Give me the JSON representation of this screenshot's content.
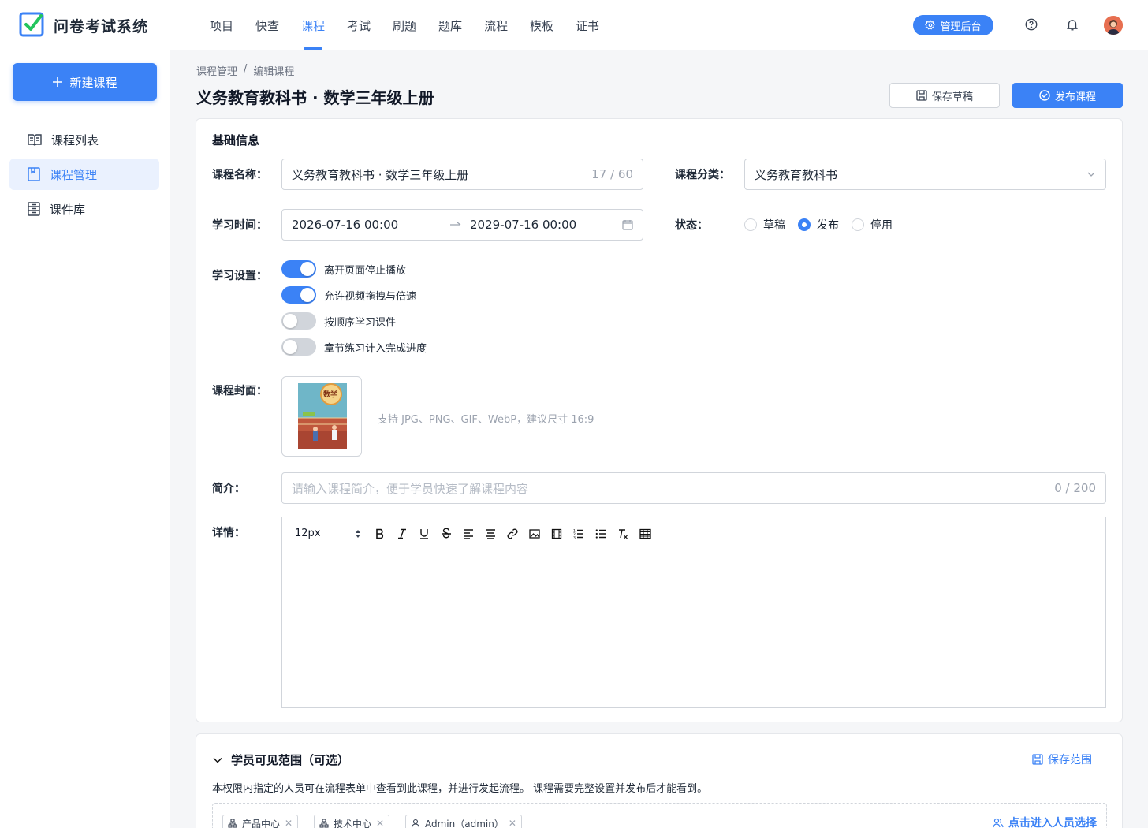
{
  "app": {
    "brand": "问卷考试系统"
  },
  "nav": {
    "items": [
      "项目",
      "快查",
      "课程",
      "考试",
      "刷题",
      "题库",
      "流程",
      "模板",
      "证书"
    ],
    "active": "课程"
  },
  "header": {
    "admin_label": "管理后台"
  },
  "sidebar": {
    "new_label": "新建课程",
    "items": [
      {
        "label": "课程列表"
      },
      {
        "label": "课程管理"
      },
      {
        "label": "课件库"
      }
    ]
  },
  "breadcrumb": {
    "parent": "课程管理",
    "sep": "/",
    "current": "编辑课程"
  },
  "page": {
    "title": "义务教育教科书 · 数学三年级上册",
    "save_draft": "保存草稿",
    "publish": "发布课程"
  },
  "basic": {
    "section_title": "基础信息",
    "name_label": "课程名称：",
    "name_value": "义务教育教科书 · 数学三年级上册",
    "name_count": "17 / 60",
    "category_label": "课程分类：",
    "category_value": "义务教育教科书",
    "time_label": "学习时间：",
    "time_start": "2026-07-16 00:00",
    "time_end": "2029-07-16 00:00",
    "status_label": "状态：",
    "status_options": [
      "草稿",
      "发布",
      "停用"
    ],
    "status_selected": "发布",
    "settings_label": "学习设置：",
    "settings": [
      {
        "label": "离开页面停止播放",
        "on": true
      },
      {
        "label": "允许视频拖拽与倍速",
        "on": true
      },
      {
        "label": "按顺序学习课件",
        "on": false
      },
      {
        "label": "章节练习计入完成进度",
        "on": false
      }
    ],
    "cover_label": "课程封面：",
    "cover_badge": "数学",
    "cover_hint": "支持 JPG、PNG、GIF、WebP，建议尺寸 16:9",
    "intro_label": "简介：",
    "intro_placeholder": "请输入课程简介，便于学员快速了解课程内容",
    "intro_count": "0 / 200",
    "detail_label": "详情：",
    "font_size": "12px"
  },
  "scope": {
    "title": "学员可见范围（可选）",
    "save_label": "保存范围",
    "description": "本权限内指定的人员可在流程表单中查看到此课程，并进行发起流程。 课程需要完整设置并发布后才能看到。",
    "tags": [
      "产品中心",
      "技术中心",
      "Admin（admin）"
    ],
    "pick_label": "点击进入人员选择"
  },
  "colors": {
    "accent": "#3b82f6",
    "border": "#d1d5db",
    "muted": "#9ca3af"
  }
}
